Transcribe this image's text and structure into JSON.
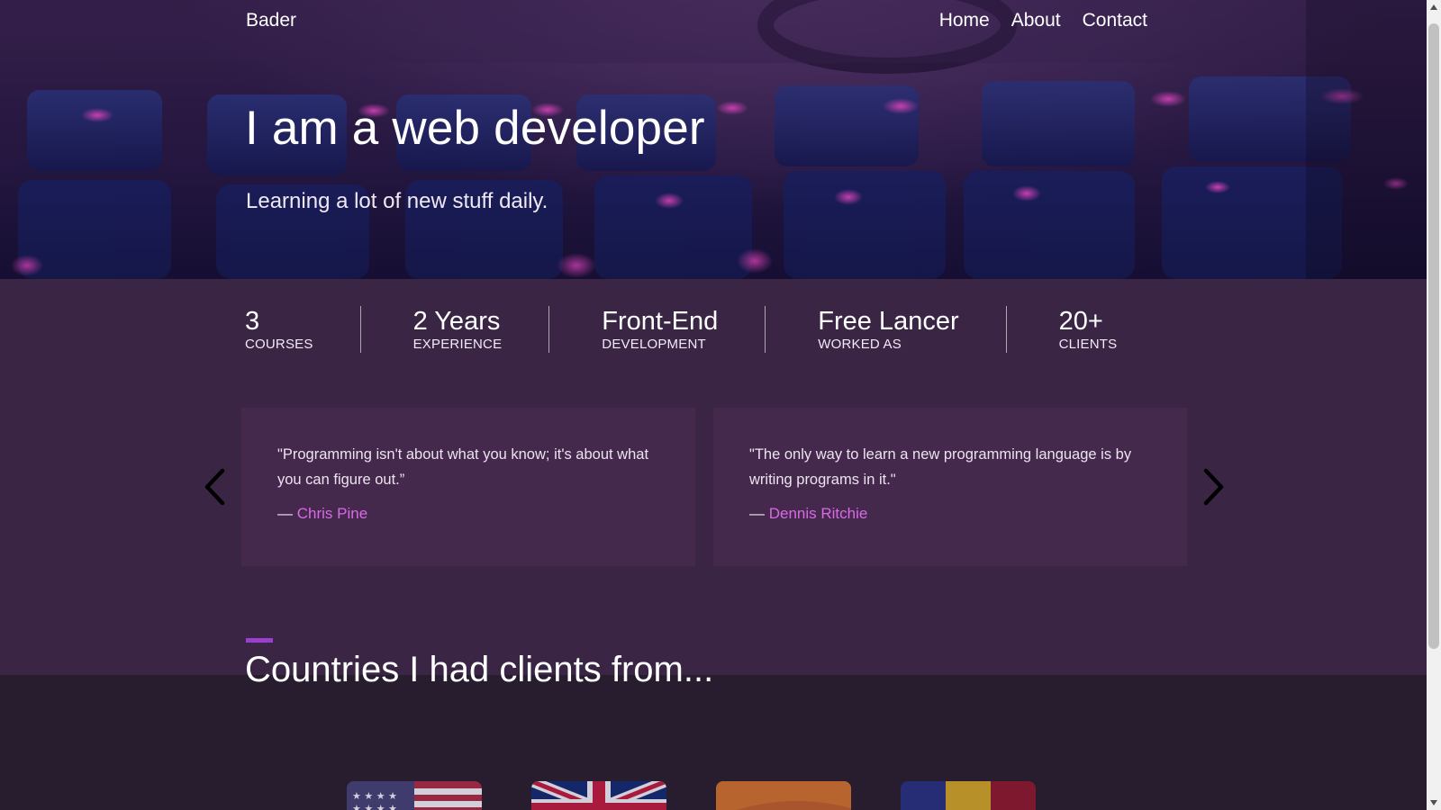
{
  "header": {
    "brand": "Bader",
    "nav": [
      {
        "label": "Home"
      },
      {
        "label": "About"
      },
      {
        "label": "Contact"
      }
    ]
  },
  "hero": {
    "title": "I am a web developer",
    "subtitle": "Learning a lot of new stuff daily."
  },
  "stats": [
    {
      "value": "3",
      "label": "COURSES"
    },
    {
      "value": "2 Years",
      "label": "EXPERIENCE"
    },
    {
      "value": "Front-End",
      "label": "DEVELOPMENT"
    },
    {
      "value": "Free Lancer",
      "label": "WORKED AS"
    },
    {
      "value": "20+",
      "label": "CLIENTS"
    }
  ],
  "quotes": [
    {
      "text": "\"Programming isn't about what you know; it's about what you can figure out.”",
      "dash": "—",
      "author": "Chris Pine"
    },
    {
      "text": "\"The only way to learn a new programming language is by writing programs in it.\"",
      "dash": "—",
      "author": "Dennis Ritchie"
    }
  ],
  "countries": {
    "title": "Countries I had clients from...",
    "flags": [
      "us-flag-icon",
      "uk-flag-icon",
      "spain-flag-icon",
      "romania-flag-icon"
    ]
  },
  "colors": {
    "accent": "#9b3fd0",
    "author_name": "#d86ae6",
    "stats_bg": "#3a2545",
    "card_bg": "#45294d",
    "lower_bg": "#281c2f"
  }
}
